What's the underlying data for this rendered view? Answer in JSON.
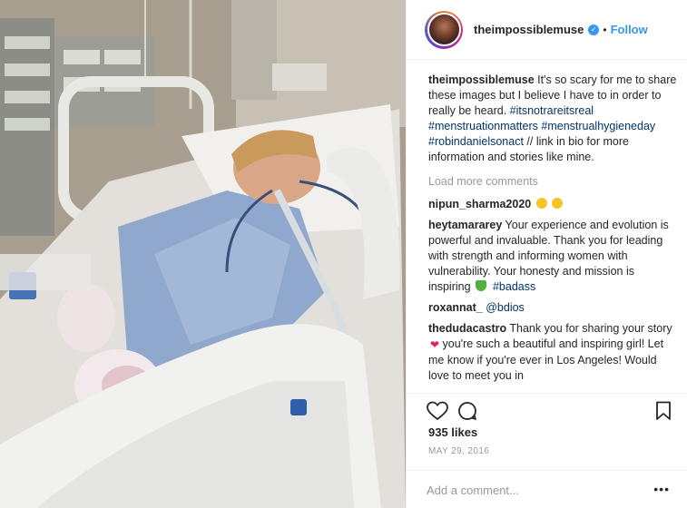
{
  "post": {
    "username": "theimpossiblemuse",
    "follow_label": "Follow",
    "dot": "•",
    "verified_icon": "check-icon"
  },
  "caption": {
    "username": "theimpossiblemuse",
    "text": " It's so scary for me to share these images but I believe I have to in order to really be heard. ",
    "tags": [
      "#itsnotrareitsreal",
      "#menstruationmatters",
      "#menstrualhygieneday",
      "#robindanielsonact"
    ],
    "tail": " // link in bio for more information and stories like mine."
  },
  "load_more": "Load more comments",
  "comments": [
    {
      "username": "nipun_sharma2020",
      "text": " "
    },
    {
      "username": "heytamararey",
      "text": " Your experience and evolution is powerful and invaluable. Thank you for leading with strength and informing women with vulnerability. Your honesty and mission is inspiring ",
      "tag": "#badass"
    },
    {
      "username": "roxannat_",
      "text": " ",
      "mention": "@bdios"
    },
    {
      "username": "thedudacastro",
      "text1": " Thank you for sharing your story ",
      "text2": " you're such a beautiful and inspiring girl! Let me know if you're ever in Los Angeles! Would love to meet you in"
    }
  ],
  "likes": "935 likes",
  "date": "MAY 29, 2016",
  "add_comment_placeholder": "Add a comment...",
  "more_label": "•••",
  "colors": {
    "link": "#3897f0",
    "hashtag": "#003569",
    "muted": "#999999"
  }
}
